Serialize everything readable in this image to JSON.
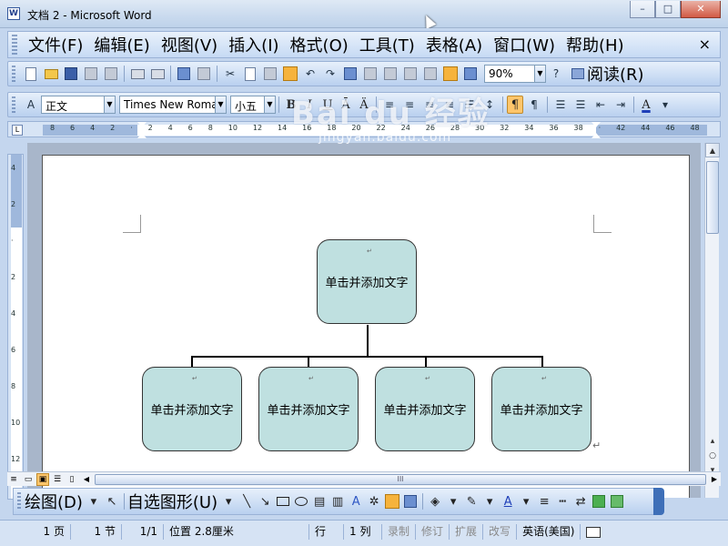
{
  "window": {
    "title": "文档 2 - Microsoft Word",
    "app_icon": "W"
  },
  "window_controls": {
    "minimize": "–",
    "maximize": "□",
    "close": "✕"
  },
  "menu": {
    "items": [
      "文件(F)",
      "编辑(E)",
      "视图(V)",
      "插入(I)",
      "格式(O)",
      "工具(T)",
      "表格(A)",
      "窗口(W)",
      "帮助(H)"
    ],
    "close": "×"
  },
  "standard_toolbar": {
    "zoom": "90%",
    "read_label": "阅读(R)"
  },
  "format_toolbar": {
    "style": "正文",
    "font": "Times New Roman",
    "size": "小五",
    "bold": "B",
    "italic": "I",
    "underline": "U",
    "font_color_letter": "A"
  },
  "ruler": {
    "tab_selector": "L",
    "numbers": [
      "8",
      "6",
      "4",
      "2",
      "",
      "2",
      "4",
      "6",
      "8",
      "10",
      "12",
      "14",
      "16",
      "18",
      "20",
      "22",
      "24",
      "26",
      "28",
      "30",
      "32",
      "34",
      "36",
      "38",
      "",
      "42",
      "44",
      "46",
      "48"
    ],
    "vertical_numbers": [
      "4",
      "2",
      "",
      "2",
      "4",
      "6",
      "8",
      "10",
      "12"
    ]
  },
  "org_chart": {
    "root": "单击并添加文字",
    "children": [
      "单击并添加文字",
      "单击并添加文字",
      "单击并添加文字",
      "单击并添加文字"
    ],
    "box_color": "#bfe0e0"
  },
  "hscroll": {
    "thumb_grip": "III"
  },
  "drawing_toolbar": {
    "draw_label": "绘图(D)",
    "autoshape_label": "自选图形(U)"
  },
  "status": {
    "page": "1 页",
    "section": "1 节",
    "page_of": "1/1",
    "position": "位置 2.8厘米",
    "line": "行",
    "column": "1 列",
    "record": "录制",
    "revise": "修订",
    "extend": "扩展",
    "overwrite": "改写",
    "language": "英语(美国)"
  },
  "watermark": {
    "text": "Bai du 经验",
    "url": "jingyan.baidu.com"
  }
}
